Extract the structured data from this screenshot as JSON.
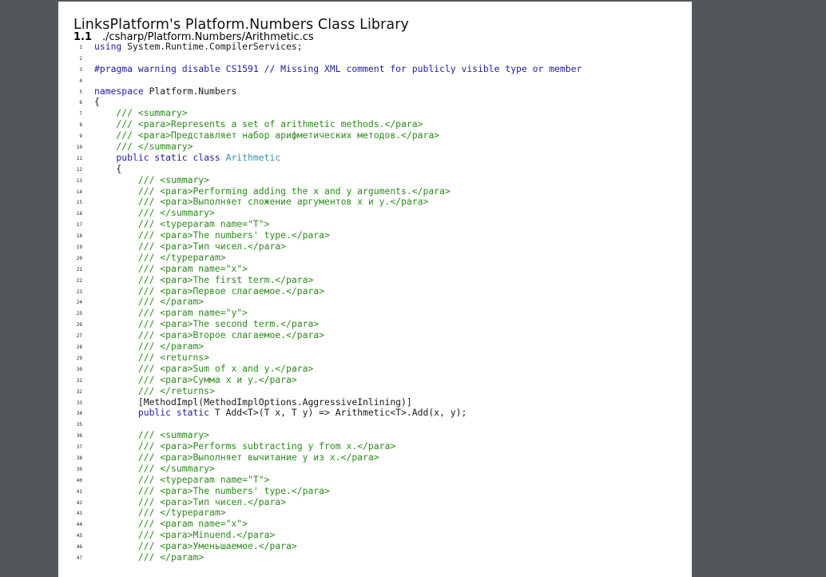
{
  "document": {
    "title": "LinksPlatform's Platform.Numbers Class Library",
    "section_number": "1.1",
    "section_path": "./csharp/Platform.Numbers/Arithmetic.cs"
  },
  "code_lines": [
    {
      "n": "1",
      "segs": [
        {
          "t": "kw",
          "s": "using"
        },
        {
          "t": "",
          "s": " System.Runtime.CompilerServices;"
        }
      ]
    },
    {
      "n": "2",
      "segs": []
    },
    {
      "n": "3",
      "segs": [
        {
          "t": "pp",
          "s": "#pragma warning disable CS1591 // Missing XML comment for publicly visible type or member"
        }
      ]
    },
    {
      "n": "4",
      "segs": []
    },
    {
      "n": "5",
      "segs": [
        {
          "t": "kw",
          "s": "namespace"
        },
        {
          "t": "",
          "s": " Platform.Numbers"
        }
      ]
    },
    {
      "n": "6",
      "segs": [
        {
          "t": "",
          "s": "{"
        }
      ]
    },
    {
      "n": "7",
      "segs": [
        {
          "t": "cm",
          "s": "    /// <summary>"
        }
      ]
    },
    {
      "n": "8",
      "segs": [
        {
          "t": "cm",
          "s": "    /// <para>Represents a set of arithmetic methods.</para>"
        }
      ]
    },
    {
      "n": "9",
      "segs": [
        {
          "t": "cm",
          "s": "    /// <para>Представляет набор арифметических методов.</para>"
        }
      ]
    },
    {
      "n": "10",
      "segs": [
        {
          "t": "cm",
          "s": "    /// </summary>"
        }
      ]
    },
    {
      "n": "11",
      "segs": [
        {
          "t": "kw",
          "s": "    public static class"
        },
        {
          "t": "",
          "s": " "
        },
        {
          "t": "cls",
          "s": "Arithmetic"
        }
      ]
    },
    {
      "n": "12",
      "segs": [
        {
          "t": "",
          "s": "    {"
        }
      ]
    },
    {
      "n": "13",
      "segs": [
        {
          "t": "cm",
          "s": "        /// <summary>"
        }
      ]
    },
    {
      "n": "14",
      "segs": [
        {
          "t": "cm",
          "s": "        /// <para>Performing adding the x and y arguments.</para>"
        }
      ]
    },
    {
      "n": "15",
      "segs": [
        {
          "t": "cm",
          "s": "        /// <para>Выполняет сложение аргументов x и y.</para>"
        }
      ]
    },
    {
      "n": "16",
      "segs": [
        {
          "t": "cm",
          "s": "        /// </summary>"
        }
      ]
    },
    {
      "n": "17",
      "segs": [
        {
          "t": "cm",
          "s": "        /// <typeparam name=\"T\">"
        }
      ]
    },
    {
      "n": "18",
      "segs": [
        {
          "t": "cm",
          "s": "        /// <para>The numbers' type.</para>"
        }
      ]
    },
    {
      "n": "19",
      "segs": [
        {
          "t": "cm",
          "s": "        /// <para>Тип чисел.</para>"
        }
      ]
    },
    {
      "n": "20",
      "segs": [
        {
          "t": "cm",
          "s": "        /// </typeparam>"
        }
      ]
    },
    {
      "n": "21",
      "segs": [
        {
          "t": "cm",
          "s": "        /// <param name=\"x\">"
        }
      ]
    },
    {
      "n": "22",
      "segs": [
        {
          "t": "cm",
          "s": "        /// <para>The first term.</para>"
        }
      ]
    },
    {
      "n": "23",
      "segs": [
        {
          "t": "cm",
          "s": "        /// <para>Первое слагаемое.</para>"
        }
      ]
    },
    {
      "n": "24",
      "segs": [
        {
          "t": "cm",
          "s": "        /// </param>"
        }
      ]
    },
    {
      "n": "25",
      "segs": [
        {
          "t": "cm",
          "s": "        /// <param name=\"y\">"
        }
      ]
    },
    {
      "n": "26",
      "segs": [
        {
          "t": "cm",
          "s": "        /// <para>The second term.</para>"
        }
      ]
    },
    {
      "n": "27",
      "segs": [
        {
          "t": "cm",
          "s": "        /// <para>Второе слагаемое.</para>"
        }
      ]
    },
    {
      "n": "28",
      "segs": [
        {
          "t": "cm",
          "s": "        /// </param>"
        }
      ]
    },
    {
      "n": "29",
      "segs": [
        {
          "t": "cm",
          "s": "        /// <returns>"
        }
      ]
    },
    {
      "n": "30",
      "segs": [
        {
          "t": "cm",
          "s": "        /// <para>Sum of x and y.</para>"
        }
      ]
    },
    {
      "n": "31",
      "segs": [
        {
          "t": "cm",
          "s": "        /// <para>Сумма x и y.</para>"
        }
      ]
    },
    {
      "n": "32",
      "segs": [
        {
          "t": "cm",
          "s": "        /// </returns>"
        }
      ]
    },
    {
      "n": "33",
      "segs": [
        {
          "t": "",
          "s": "        [MethodImpl(MethodImplOptions.AggressiveInlining)]"
        }
      ]
    },
    {
      "n": "34",
      "segs": [
        {
          "t": "kw",
          "s": "        public static"
        },
        {
          "t": "",
          "s": " T Add<T>(T x, T y) => Arithmetic<T>.Add(x, y);"
        }
      ]
    },
    {
      "n": "35",
      "segs": []
    },
    {
      "n": "36",
      "segs": [
        {
          "t": "cm",
          "s": "        /// <summary>"
        }
      ]
    },
    {
      "n": "37",
      "segs": [
        {
          "t": "cm",
          "s": "        /// <para>Performs subtracting y from x.</para>"
        }
      ]
    },
    {
      "n": "38",
      "segs": [
        {
          "t": "cm",
          "s": "        /// <para>Выполняет вычитание y из x.</para>"
        }
      ]
    },
    {
      "n": "39",
      "segs": [
        {
          "t": "cm",
          "s": "        /// </summary>"
        }
      ]
    },
    {
      "n": "40",
      "segs": [
        {
          "t": "cm",
          "s": "        /// <typeparam name=\"T\">"
        }
      ]
    },
    {
      "n": "41",
      "segs": [
        {
          "t": "cm",
          "s": "        /// <para>The numbers' type.</para>"
        }
      ]
    },
    {
      "n": "42",
      "segs": [
        {
          "t": "cm",
          "s": "        /// <para>Тип чисел.</para>"
        }
      ]
    },
    {
      "n": "43",
      "segs": [
        {
          "t": "cm",
          "s": "        /// </typeparam>"
        }
      ]
    },
    {
      "n": "44",
      "segs": [
        {
          "t": "cm",
          "s": "        /// <param name=\"x\">"
        }
      ]
    },
    {
      "n": "45",
      "segs": [
        {
          "t": "cm",
          "s": "        /// <para>Minuend.</para>"
        }
      ]
    },
    {
      "n": "46",
      "segs": [
        {
          "t": "cm",
          "s": "        /// <para>Уменьшаемое.</para>"
        }
      ]
    },
    {
      "n": "47",
      "segs": [
        {
          "t": "cm",
          "s": "        /// </param>"
        }
      ]
    }
  ],
  "colors": {
    "keyword": "#1f1f9e",
    "comment": "#2b8a1b",
    "class_name": "#3d8fb0",
    "viewer_background": "#53575a",
    "page": "#ffffff"
  }
}
